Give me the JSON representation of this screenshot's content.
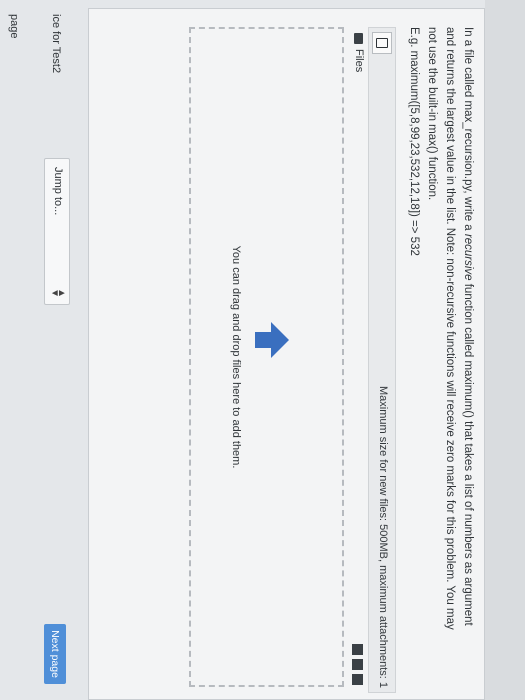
{
  "question": {
    "line1_prefix": "In a file called max_recursion.py, write a ",
    "line1_emph": "recursive",
    "line1_suffix": " function called maximum() that takes a list of numbers as argument",
    "line2": "and returns the largest value in the list. Note: non-recursive functions will receive zero marks for this problem. You may",
    "line3": "not use the built-in max() function.",
    "example": "E.g. maximum([5,8,99,23,532,12,18]) => 532"
  },
  "attachments": {
    "max_size_text": "Maximum size for new files: 500MB, maximum attachments: 1",
    "files_label": "Files",
    "drop_text": "You can drag and drop files here to add them."
  },
  "navigation": {
    "prev_link": "ice for Test2",
    "page_link": "page",
    "jump_label": "Jump to...",
    "next_button": "Next page"
  },
  "colors": {
    "accent": "#4f8fd8",
    "upload_arrow": "#3a6fbf"
  },
  "icons": {
    "file_picker": "file-icon",
    "folder": "folder-icon",
    "upload": "upload-arrow-icon",
    "view_grid": "grid-icon",
    "view_list": "list-icon",
    "view_folder": "folder-view-icon",
    "dropdown": "chevron-updown-icon"
  }
}
